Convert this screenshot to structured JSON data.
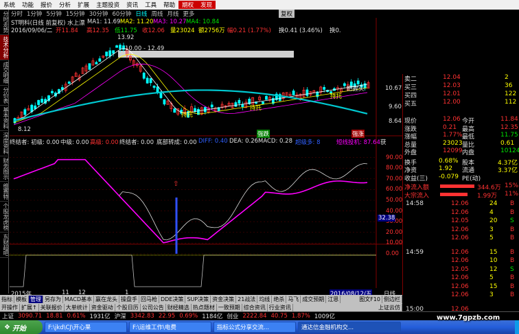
{
  "menu": {
    "items": [
      "系统",
      "功能",
      "报价",
      "分析",
      "扩展",
      "主题投资",
      "资讯",
      "工具",
      "帮助"
    ],
    "special": [
      "期权",
      "发现"
    ],
    "corner": "复权"
  },
  "periods": {
    "items": [
      "分时",
      "1分钟",
      "5分钟",
      "15分钟",
      "30分钟",
      "60分钟",
      "日线",
      "周线",
      "月线",
      "更多"
    ],
    "active": "日线",
    "right_label": "复权"
  },
  "side_tabs": [
    {
      "label": "分时走势",
      "active": false
    },
    {
      "label": "技术分析",
      "active": true
    },
    {
      "label": "成交明细",
      "active": false
    },
    {
      "label": "分价表",
      "active": false
    },
    {
      "label": "基本资料",
      "active": false
    },
    {
      "label": "深度资料",
      "active": false
    },
    {
      "label": "财务图示",
      "active": false
    },
    {
      "label": "维赛特",
      "active": false
    },
    {
      "label": "个股龙虎榜",
      "active": false
    },
    {
      "label": "东财超吧",
      "active": false
    }
  ],
  "chart_header": {
    "line1_title": "ST明科(日线 前复权) 水上漂",
    "ma1": "MA1: 11.69",
    "ma2": "MA2: 11.20",
    "ma3": "MA3: 10.27",
    "ma4": "MA4: 10.84",
    "line2_date": "2016/09/06/二",
    "line2_open": "开11.84",
    "line2_high": "高12.35",
    "line2_low": "低11.75",
    "line2_close": "收12.06",
    "line2_vol": "量23024",
    "line2_amt": "额2756万",
    "line2_chg": "幅0.21 (1.77%)",
    "line2_turnover": "换0.41 (3.46%)",
    "line2_extra": "换0."
  },
  "price_axis": [
    "10.67",
    "9.60",
    "8.64"
  ],
  "price_marks": {
    "high": "13.92",
    "low": "8.12",
    "range_label": "10.00 - 12.49",
    "annotations": [
      "持托",
      "持托",
      "持托"
    ],
    "top_note": "把握头",
    "badge_green": "强跌",
    "badge_red": "强涨"
  },
  "indicator_header": {
    "text1": "终结者: 初级: 0.00",
    "text2": "中级: 0.00",
    "text3": "高级: 0.00",
    "text4": "终结者: 0.00",
    "text5": "底部转成: 0.00",
    "text6": "DIFF: 0.40",
    "text7": "DEA: 0.26",
    "text8": "MACD: 0.28",
    "text9": "超级多: 8",
    "text10": "短线投机: 87.64",
    "text11": "获"
  },
  "indicator_axis": [
    "90.00",
    "80.00",
    "70.00",
    "60.00",
    "50.00",
    "40.00",
    "30.00",
    "20.00",
    "10.00",
    "0.00"
  ],
  "indicator_marker": "32.38",
  "time_axis": [
    "2015年",
    "11",
    "12",
    "1",
    "2016/08/12/五",
    "日线"
  ],
  "quote": {
    "sell": [
      {
        "label": "卖二",
        "price": "12.04",
        "vol": "2"
      },
      {
        "label": "买三",
        "price": "12.03",
        "vol": "36"
      },
      {
        "label": "买四",
        "price": "12.01",
        "vol": "122"
      },
      {
        "label": "买五",
        "price": "12.00",
        "vol": "112"
      }
    ],
    "stats": [
      {
        "k1": "现价",
        "v1": "12.06",
        "k2": "今开",
        "v2": "11.84"
      },
      {
        "k1": "涨跌",
        "v1": "0.21",
        "k2": "最高",
        "v2": "12.35"
      },
      {
        "k1": "涨幅",
        "v1": "1.77%",
        "k2": "最低",
        "v2": "11.75"
      },
      {
        "k1": "总量",
        "v1": "23023",
        "k2": "量比",
        "v2": "0.61"
      },
      {
        "k1": "外盘",
        "v1": "12099",
        "k2": "内盘",
        "v2": "10124"
      }
    ],
    "stats2": [
      {
        "k1": "换手",
        "v1": "0.68%",
        "k2": "股本",
        "v2": "4.37亿"
      },
      {
        "k1": "净资",
        "v1": "1.92",
        "k2": "流通",
        "v2": "3.37亿"
      },
      {
        "k1": "收益(三)",
        "v1": "-0.079",
        "k2": "PE(动)",
        "v2": ""
      }
    ],
    "flow": [
      {
        "label": "净流入额",
        "value": "344.6万",
        "pct": "15%"
      },
      {
        "label": "大宗流入",
        "value": "1.99万",
        "pct": "11%"
      }
    ],
    "ticks": [
      {
        "time": "14:58",
        "price": "12.06",
        "vol": "24",
        "side": "B"
      },
      {
        "time": "",
        "price": "12.06",
        "vol": "4",
        "side": "B"
      },
      {
        "time": "",
        "price": "12.05",
        "vol": "20",
        "side": "S"
      },
      {
        "time": "",
        "price": "12.06",
        "vol": "3",
        "side": "B"
      },
      {
        "time": "",
        "price": "12.06",
        "vol": "5",
        "side": "B"
      },
      {
        "time": "14:59",
        "price": "12.06",
        "vol": "15",
        "side": "B"
      },
      {
        "time": "",
        "price": "12.06",
        "vol": "10",
        "side": "B"
      },
      {
        "time": "",
        "price": "12.05",
        "vol": "12",
        "side": "S"
      },
      {
        "time": "",
        "price": "12.06",
        "vol": "5",
        "side": "B"
      },
      {
        "time": "",
        "price": "12.06",
        "vol": "15",
        "side": "B"
      },
      {
        "time": "",
        "price": "12.06",
        "vol": "3",
        "side": "B"
      },
      {
        "time": "15:00",
        "price": "12.06",
        "vol": "",
        "side": ""
      }
    ]
  },
  "bottom_tabs_1": [
    "指标",
    "模板",
    "管理",
    "另存为",
    "MACD基本",
    "赢在龙头",
    "操盘手",
    "回马枪",
    "DDE决策",
    "SUP决策",
    "资金决策",
    "21战法",
    "均线",
    "绝杀",
    "马飞",
    "成交预期",
    "江恩"
  ],
  "bottom_tabs_1_active": "管理",
  "bottom_tabs_1_right": [
    "图文F10",
    "侧边栏"
  ],
  "bottom_tabs_2": [
    "开操作",
    "扩展↑",
    "关联报价",
    "大单统计",
    "资金驱动",
    "个股日历",
    "公司公告",
    "财经精选",
    "热点题材",
    "一致预期",
    "综合资讯",
    "行业资讯"
  ],
  "bottom_tabs_2_right": [
    "上证云仿"
  ],
  "status_bar": [
    {
      "text": "上证",
      "cls": "white"
    },
    {
      "text": "3090.71",
      "cls": "red"
    },
    {
      "text": "18.81",
      "cls": "red"
    },
    {
      "text": "0.61%",
      "cls": "red"
    },
    {
      "text": "1931亿",
      "cls": "white"
    },
    {
      "text": "沪深",
      "cls": "white"
    },
    {
      "text": "3342.83",
      "cls": "red"
    },
    {
      "text": "22.95",
      "cls": "red"
    },
    {
      "text": "0.69%",
      "cls": "red"
    },
    {
      "text": "1184亿",
      "cls": "white"
    },
    {
      "text": "创业",
      "cls": "white"
    },
    {
      "text": "2222.84",
      "cls": "red"
    },
    {
      "text": "40.75",
      "cls": "red"
    },
    {
      "text": "1.87%",
      "cls": "red"
    },
    {
      "text": "1009亿",
      "cls": "white"
    }
  ],
  "taskbar": {
    "start": "开始",
    "tasks": [
      "F:\\jkd\\CJ\\开心果",
      "F:\\运维工作\\电费",
      "指标公式分享交流...",
      "通达信金融机构交..."
    ],
    "active_index": 3
  },
  "watermark": "www.7gpzb.com",
  "colors": {
    "up": "#ff3232",
    "down": "#00e600",
    "ma_cyan": "#00c8d0",
    "magenta": "#ff00ff"
  }
}
